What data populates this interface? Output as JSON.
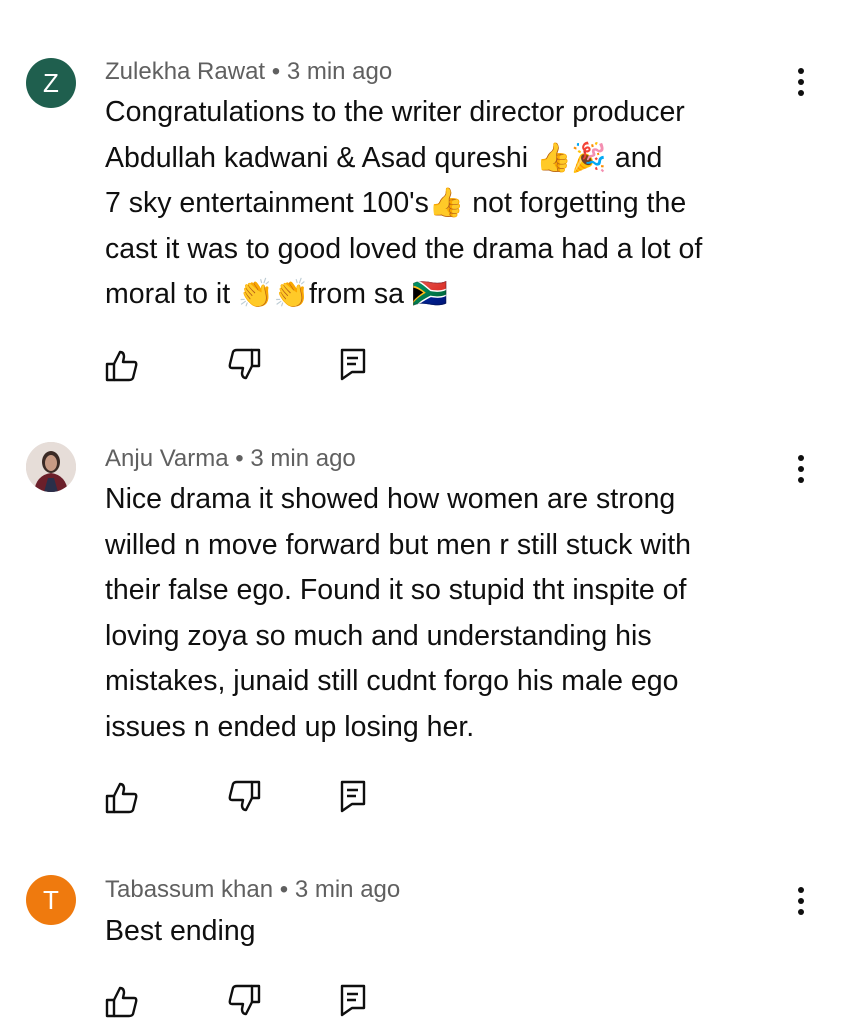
{
  "comments": [
    {
      "avatar_letter": "Z",
      "avatar_color": "#1f5f4e",
      "author": "Zulekha Rawat",
      "separator": "•",
      "time": "3 min ago",
      "text": "Congratulations to the writer director producer\nAbdullah kadwani & Asad qureshi 👍🎉 and\n7 sky entertainment 100's👍 not forgetting the\ncast it was to good loved the drama had a lot of\nmoral to it 👏👏from sa 🇿🇦"
    },
    {
      "avatar_letter": "",
      "avatar_color": "#dcd3cf",
      "author": "Anju Varma",
      "separator": "•",
      "time": "3 min ago",
      "text": "Nice drama it showed how women are strong\nwilled n move forward but men r still stuck with\ntheir false ego. Found it so stupid tht inspite of\nloving zoya so much and understanding his\nmistakes, junaid still cudnt forgo his male ego\nissues n ended up losing her."
    },
    {
      "avatar_letter": "T",
      "avatar_color": "#ef7a0e",
      "author": "Tabassum khan",
      "separator": "•",
      "time": "3 min ago",
      "text": "Best ending"
    }
  ],
  "icons": {
    "like": "thumb-up-icon",
    "dislike": "thumb-down-icon",
    "reply": "reply-comment-icon",
    "more": "more-vertical-icon"
  }
}
